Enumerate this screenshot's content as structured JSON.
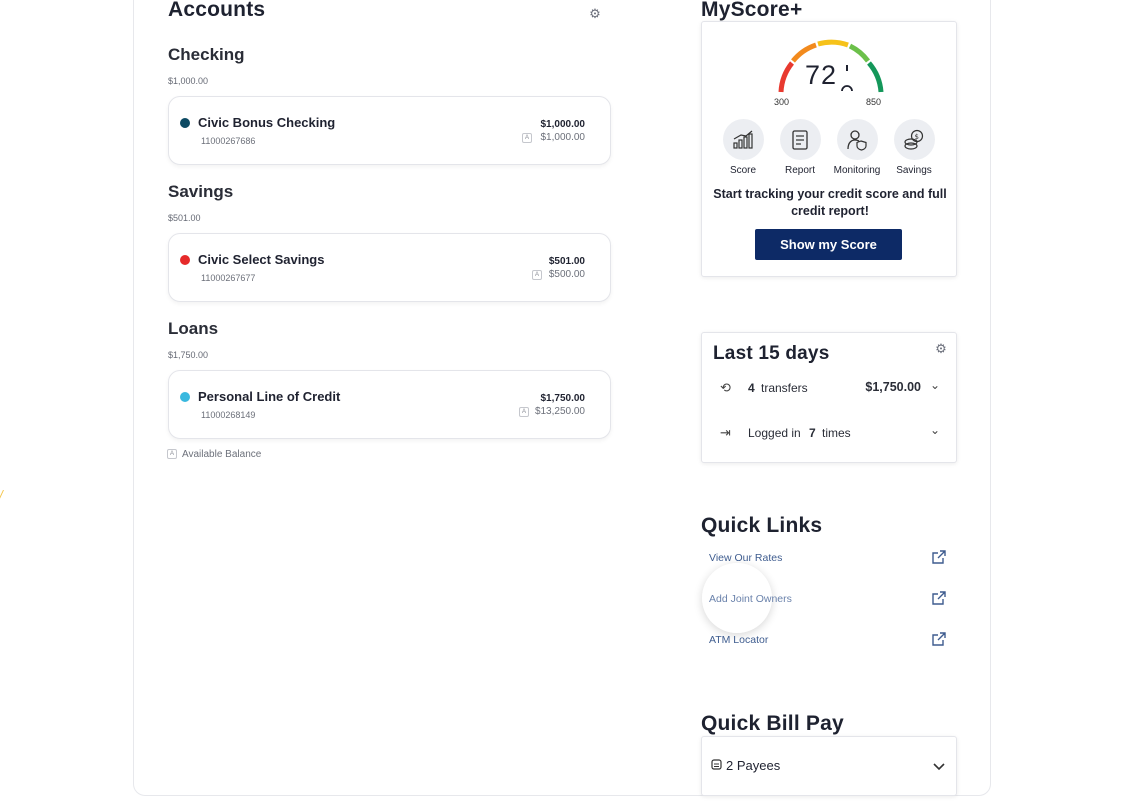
{
  "accounts": {
    "title": "Accounts",
    "groups": [
      {
        "name": "Checking",
        "total": "$1,000.00",
        "account": {
          "name": "Civic Bonus Checking",
          "number": "11000267686",
          "balance": "$1,000.00",
          "available": "$1,000.00",
          "color": "#0d4a63"
        }
      },
      {
        "name": "Savings",
        "total": "$501.00",
        "account": {
          "name": "Civic Select Savings",
          "number": "11000267677",
          "balance": "$501.00",
          "available": "$500.00",
          "color": "#e62a2a"
        }
      },
      {
        "name": "Loans",
        "total": "$1,750.00",
        "account": {
          "name": "Personal Line of Credit",
          "number": "11000268149",
          "balance": "$1,750.00",
          "available": "$13,250.00",
          "color": "#39b8df"
        }
      }
    ],
    "legend": {
      "badge": "A",
      "label": "Available Balance"
    }
  },
  "myscore": {
    "title": "MyScore+",
    "gauge": {
      "score": "72",
      "min": "300",
      "max": "850"
    },
    "features": [
      {
        "label": "Score",
        "icon": "bar-chart-icon"
      },
      {
        "label": "Report",
        "icon": "report-icon"
      },
      {
        "label": "Monitoring",
        "icon": "user-shield-icon"
      },
      {
        "label": "Savings",
        "icon": "coins-icon"
      }
    ],
    "cta_text": "Start tracking your credit score and full credit report!",
    "button": "Show my Score"
  },
  "last15": {
    "title": "Last 15 days",
    "transfers": {
      "count": "4",
      "label": "transfers",
      "amount": "$1,750.00"
    },
    "logins": {
      "prefix": "Logged in",
      "count": "7",
      "suffix": "times"
    }
  },
  "quick_links": {
    "title": "Quick Links",
    "items": [
      "View Our Rates",
      "Add Joint Owners",
      "ATM Locator"
    ]
  },
  "quick_bill_pay": {
    "title": "Quick Bill Pay",
    "payees": "2 Payees"
  },
  "colors": {
    "primary_button": "#0d2a66",
    "link": "#3e5c8f"
  }
}
